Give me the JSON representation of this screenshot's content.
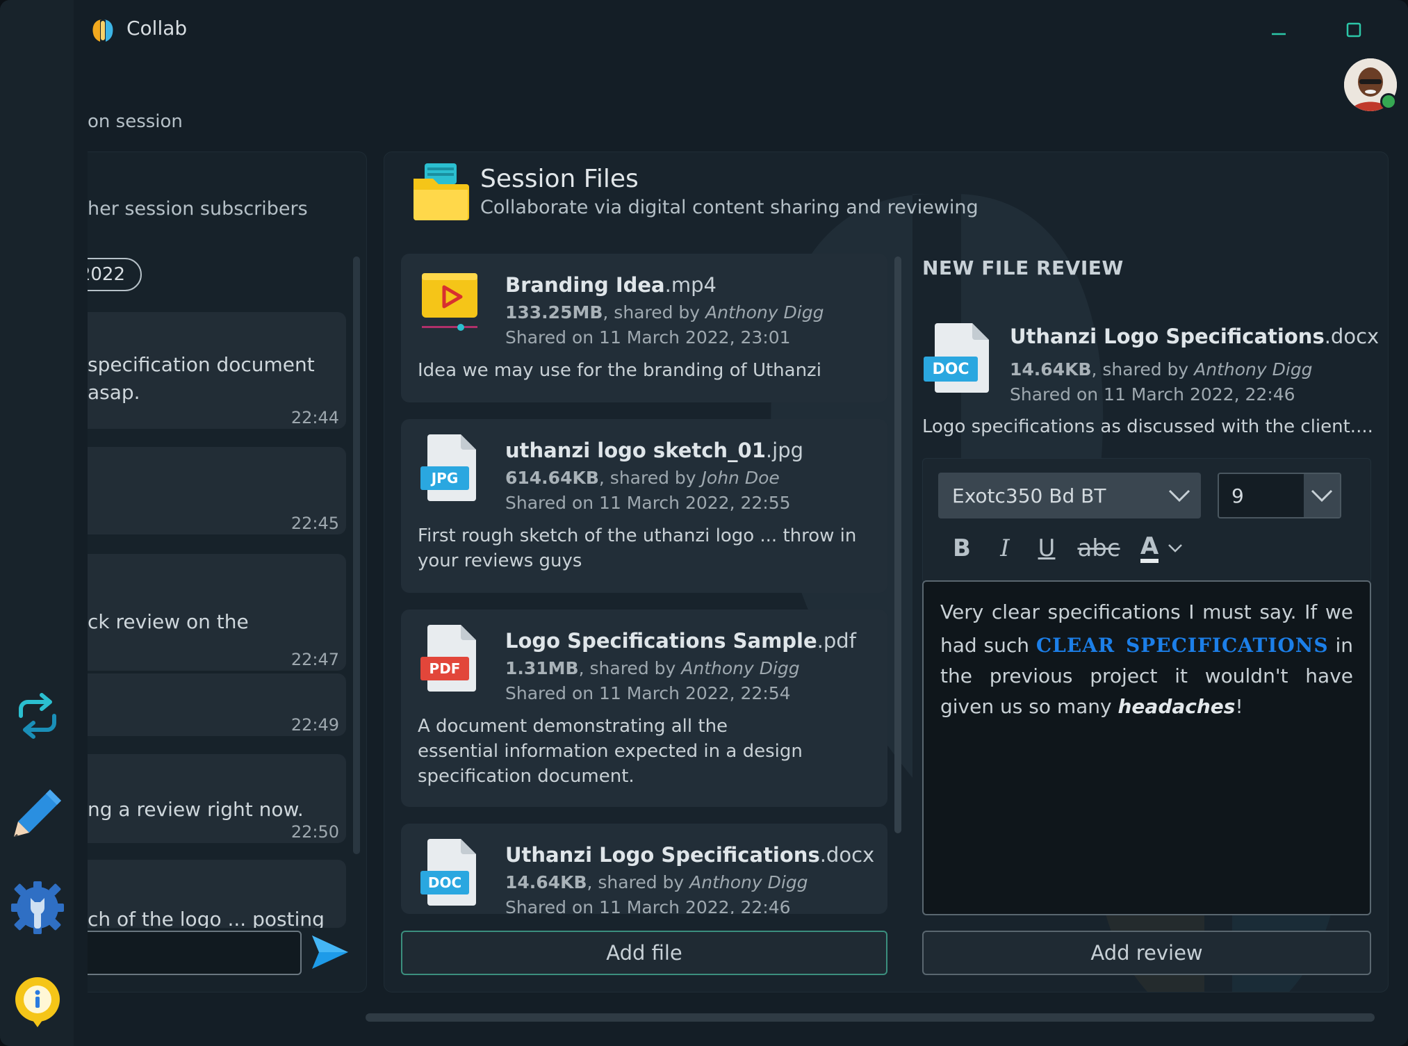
{
  "app": {
    "title": "Collab"
  },
  "page": {
    "subtitle_partial": "on session"
  },
  "colors": {
    "accent_teal": "#3b8f7e",
    "accent_blue": "#1c7fe8",
    "status_online": "#36a852",
    "background": "#141e26"
  },
  "chat": {
    "header_partial": "her session subscribers",
    "date_pill_partial": "2022",
    "messages": [
      {
        "text": "specification document\nasap.",
        "time": "22:44"
      },
      {
        "text": "",
        "time": "22:45"
      },
      {
        "text": "ck review on the",
        "time": "22:47"
      },
      {
        "text": "",
        "time": "22:49"
      },
      {
        "text": "ng a review right now.",
        "time": "22:50"
      },
      {
        "text": "ch of the logo ... posting",
        "time": ""
      }
    ],
    "input_value": ""
  },
  "session": {
    "title": "Session Files",
    "subtitle": "Collaborate via digital content sharing and reviewing"
  },
  "files": [
    {
      "name": "Branding Idea",
      "ext": ".mp4",
      "size": "133.25MB",
      "shared_by": "Anthony Digg",
      "shared_on": "Shared on 11 March 2022, 23:01",
      "description": "Idea we may use for the branding of Uthanzi",
      "icon": "video-icon"
    },
    {
      "name": "uthanzi logo sketch_01",
      "ext": ".jpg",
      "size": "614.64KB",
      "shared_by": "John Doe",
      "shared_on": "Shared on 11 March 2022, 22:55",
      "description": "First rough sketch of the uthanzi logo ... throw in your reviews guys",
      "icon": "jpg-file-icon",
      "badge": "JPG"
    },
    {
      "name": "Logo Specifications Sample",
      "ext": ".pdf",
      "size": "1.31MB",
      "shared_by": "Anthony Digg",
      "shared_on": "Shared on 11 March 2022, 22:54",
      "description": "A document demonstrating all the essential information expected in a design specification document.",
      "icon": "pdf-file-icon",
      "badge": "PDF"
    },
    {
      "name": "Uthanzi Logo Specifications",
      "ext": ".docx",
      "size": "14.64KB",
      "shared_by": "Anthony Digg",
      "shared_on": "Shared on 11 March 2022, 22:46",
      "description": "",
      "icon": "doc-file-icon",
      "badge": "DOC"
    }
  ],
  "shared_by_prefix": ", shared by ",
  "buttons": {
    "add_file": "Add file",
    "add_review": "Add review"
  },
  "review": {
    "heading": "NEW FILE REVIEW",
    "file_name": "Uthanzi Logo Specifications",
    "file_ext": ".docx",
    "size": "14.64KB",
    "shared_by": "Anthony Digg",
    "shared_on": "Shared on 11 March 2022, 22:46",
    "description": "Logo specifications as discussed with the client....",
    "badge": "DOC",
    "font_family_value": "Exotc350 Bd BT",
    "font_size_value": "9",
    "format_buttons": {
      "bold": "B",
      "italic": "I",
      "underline": "U",
      "strike": "abc",
      "color": "A"
    },
    "editor_text": {
      "part1": "Very clear specifications I must say. If we had such ",
      "highlight": "clear specifications",
      "part2": " in the previous project it wouldn't have given us so many ",
      "emphasis": "headaches",
      "part3": "!"
    }
  }
}
